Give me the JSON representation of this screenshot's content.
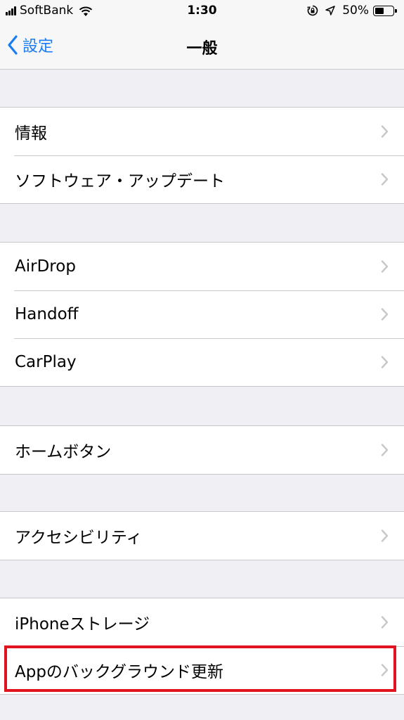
{
  "status_bar": {
    "carrier": "SoftBank",
    "time": "1:30",
    "battery_percent_label": "50%",
    "battery_level": 0.5,
    "icons": [
      "signal-icon",
      "wifi-icon",
      "rotation-lock-icon",
      "location-icon",
      "battery-icon"
    ]
  },
  "nav": {
    "back_label": "設定",
    "title": "一般"
  },
  "groups": [
    {
      "items": [
        {
          "label": "情報"
        },
        {
          "label": "ソフトウェア・アップデート"
        }
      ]
    },
    {
      "items": [
        {
          "label": "AirDrop"
        },
        {
          "label": "Handoff"
        },
        {
          "label": "CarPlay"
        }
      ]
    },
    {
      "items": [
        {
          "label": "ホームボタン"
        }
      ]
    },
    {
      "items": [
        {
          "label": "アクセシビリティ"
        }
      ]
    },
    {
      "items": [
        {
          "label": "iPhoneストレージ"
        },
        {
          "label": "Appのバックグラウンド更新"
        }
      ]
    }
  ],
  "colors": {
    "accent": "#1a7cf5",
    "highlight": "#e0141e",
    "background": "#efeff4"
  }
}
